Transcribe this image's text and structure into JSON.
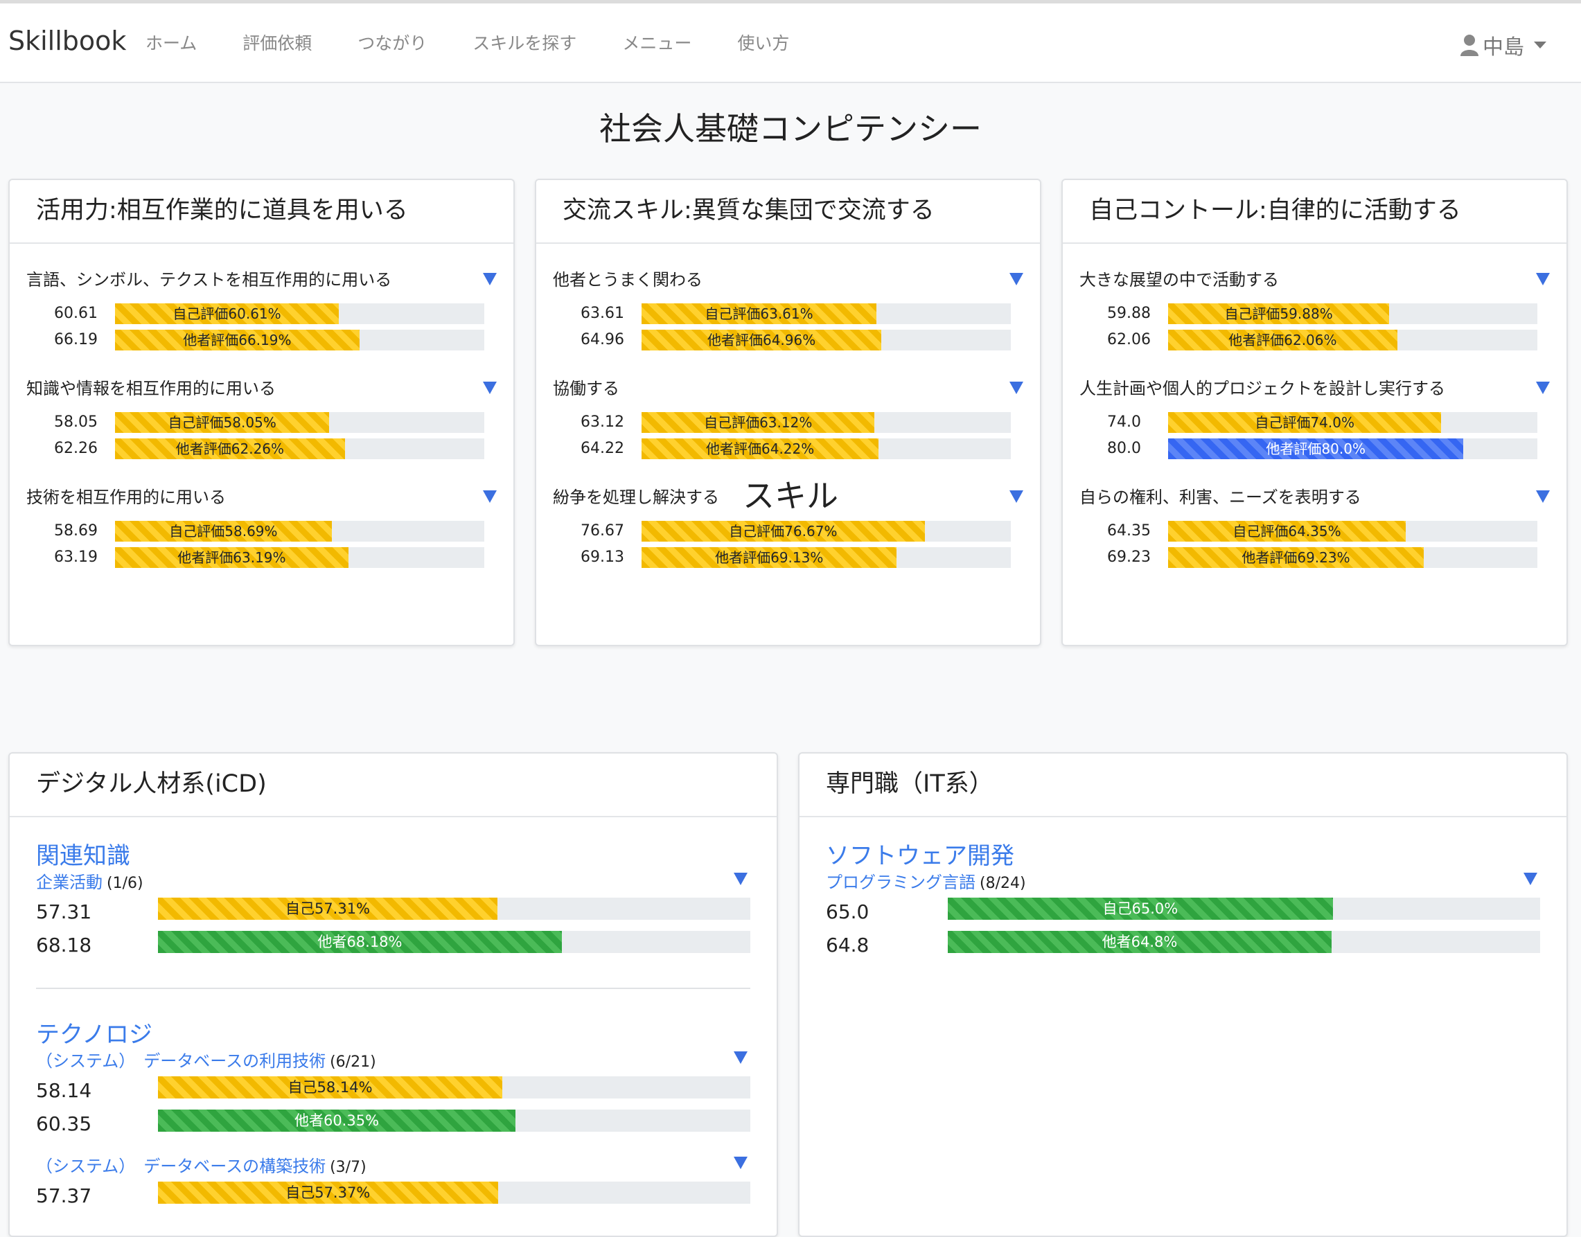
{
  "nav": {
    "brand": "Skillbook",
    "links": [
      "ホーム",
      "評価依頼",
      "つながり",
      "スキルを探す",
      "メニュー",
      "使い方"
    ],
    "user": "中島"
  },
  "competency": {
    "title": "社会人基礎コンピテンシー",
    "cards": [
      {
        "title": "活用力:相互作業的に道具を用いる",
        "items": [
          {
            "title": "言語、シンボル、テクストを相互作用的に用いる",
            "self_num": "60.61",
            "self_label": "自己評価60.61%",
            "self_value": 60.61,
            "other_num": "66.19",
            "other_label": "他者評価66.19%",
            "other_value": 66.19,
            "other_color": "yellow"
          },
          {
            "title": "知識や情報を相互作用的に用いる",
            "self_num": "58.05",
            "self_label": "自己評価58.05%",
            "self_value": 58.05,
            "other_num": "62.26",
            "other_label": "他者評価62.26%",
            "other_value": 62.26,
            "other_color": "yellow"
          },
          {
            "title": "技術を相互作用的に用いる",
            "self_num": "58.69",
            "self_label": "自己評価58.69%",
            "self_value": 58.69,
            "other_num": "63.19",
            "other_label": "他者評価63.19%",
            "other_value": 63.19,
            "other_color": "yellow"
          }
        ]
      },
      {
        "title": "交流スキル:異質な集団で交流する",
        "items": [
          {
            "title": "他者とうまく関わる",
            "self_num": "63.61",
            "self_label": "自己評価63.61%",
            "self_value": 63.61,
            "other_num": "64.96",
            "other_label": "他者評価64.96%",
            "other_value": 64.96,
            "other_color": "yellow"
          },
          {
            "title": "協働する",
            "self_num": "63.12",
            "self_label": "自己評価63.12%",
            "self_value": 63.12,
            "other_num": "64.22",
            "other_label": "他者評価64.22%",
            "other_value": 64.22,
            "other_color": "yellow"
          },
          {
            "title": "紛争を処理し解決する",
            "self_num": "76.67",
            "self_label": "自己評価76.67%",
            "self_value": 76.67,
            "other_num": "69.13",
            "other_label": "他者評価69.13%",
            "other_value": 69.13,
            "other_color": "yellow"
          }
        ]
      },
      {
        "title": "自己コントール:自律的に活動する",
        "items": [
          {
            "title": "大きな展望の中で活動する",
            "self_num": "59.88",
            "self_label": "自己評価59.88%",
            "self_value": 59.88,
            "other_num": "62.06",
            "other_label": "他者評価62.06%",
            "other_value": 62.06,
            "other_color": "yellow"
          },
          {
            "title": "人生計画や個人的プロジェクトを設計し実行する",
            "self_num": "74.0",
            "self_label": "自己評価74.0%",
            "self_value": 74.0,
            "other_num": "80.0",
            "other_label": "他者評価80.0%",
            "other_value": 80.0,
            "other_color": "blue"
          },
          {
            "title": "自らの権利、利害、ニーズを表明する",
            "self_num": "64.35",
            "self_label": "自己評価64.35%",
            "self_value": 64.35,
            "other_num": "69.23",
            "other_label": "他者評価69.23%",
            "other_value": 69.23,
            "other_color": "yellow"
          }
        ]
      }
    ]
  },
  "skills": {
    "title": "スキル",
    "cards": [
      {
        "title": "デジタル人材系(iCD)",
        "groups": [
          {
            "title": "関連知識",
            "items": [
              {
                "title": "企業活動",
                "count": "(1/6)",
                "self_num": "57.31",
                "self_label": "自己57.31%",
                "self_value": 57.31,
                "self_color": "yellow",
                "other_num": "68.18",
                "other_label": "他者68.18%",
                "other_value": 68.18,
                "other_color": "green"
              }
            ]
          },
          {
            "title": "テクノロジ",
            "items": [
              {
                "title": "（システム）　データベースの利用技術",
                "count": "(6/21)",
                "self_num": "58.14",
                "self_label": "自己58.14%",
                "self_value": 58.14,
                "self_color": "yellow",
                "other_num": "60.35",
                "other_label": "他者60.35%",
                "other_value": 60.35,
                "other_color": "green"
              },
              {
                "title": "（システム）　データベースの構築技術",
                "count": "(3/7)",
                "self_num": "57.37",
                "self_label": "自己57.37%",
                "self_value": 57.37,
                "self_color": "yellow"
              }
            ]
          }
        ]
      },
      {
        "title": "専門職（IT系）",
        "groups": [
          {
            "title": "ソフトウェア開発",
            "items": [
              {
                "title": "プログラミング言語",
                "count": "(8/24)",
                "self_num": "65.0",
                "self_label": "自己65.0%",
                "self_value": 65.0,
                "self_color": "green",
                "other_num": "64.8",
                "other_label": "他者64.8%",
                "other_value": 64.8,
                "other_color": "green"
              }
            ]
          }
        ]
      }
    ]
  }
}
